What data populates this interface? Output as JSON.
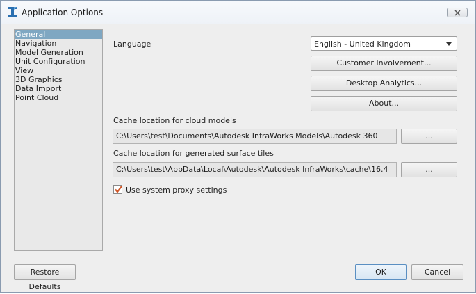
{
  "window": {
    "title": "Application Options"
  },
  "nav": {
    "items": [
      {
        "label": "General",
        "selected": true
      },
      {
        "label": "Navigation",
        "selected": false
      },
      {
        "label": "Model Generation",
        "selected": false
      },
      {
        "label": "Unit Configuration",
        "selected": false
      },
      {
        "label": "View",
        "selected": false
      },
      {
        "label": "3D Graphics",
        "selected": false
      },
      {
        "label": "Data Import",
        "selected": false
      },
      {
        "label": "Point Cloud",
        "selected": false
      }
    ]
  },
  "general": {
    "language_label": "Language",
    "language_value": "English - United Kingdom",
    "customer_involvement_label": "Customer Involvement...",
    "desktop_analytics_label": "Desktop Analytics...",
    "about_label": "About...",
    "cloud_cache_label": "Cache location for cloud models",
    "cloud_cache_path": "C:\\Users\\test\\Documents\\Autodesk InfraWorks Models\\Autodesk 360",
    "surface_cache_label": "Cache location for generated surface tiles",
    "surface_cache_path": "C:\\Users\\test\\AppData\\Local\\Autodesk\\Autodesk InfraWorks\\cache\\16.4",
    "browse_label": "...",
    "proxy_label": "Use system proxy settings",
    "proxy_checked": true
  },
  "footer": {
    "restore_label": "Restore Defaults",
    "ok_label": "OK",
    "cancel_label": "Cancel"
  },
  "colors": {
    "selection": "#7fa7c2",
    "checkmark": "#d0582a",
    "icon": "#2a6fb0"
  },
  "icons": {
    "app": "infraworks-i-icon",
    "close": "close-icon",
    "dropdown": "chevron-down-icon",
    "check": "checkmark-icon"
  }
}
